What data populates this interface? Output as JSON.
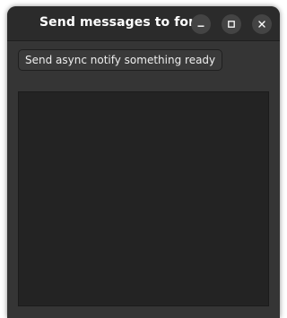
{
  "window": {
    "title": "Send messages to form",
    "controls": {
      "minimize_icon": "minimize-icon",
      "maximize_icon": "maximize-icon",
      "close_icon": "close-icon"
    }
  },
  "toolbar": {
    "send_button_label": "Send async notify something ready"
  },
  "message_area": {
    "value": ""
  },
  "colors": {
    "window_bg": "#353535",
    "titlebar_bg": "#2b2b2b",
    "text_area_bg": "#232323",
    "text": "#eeeeee"
  }
}
